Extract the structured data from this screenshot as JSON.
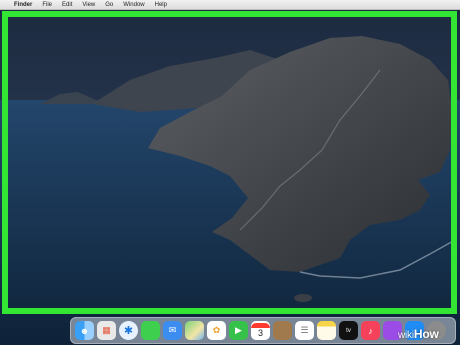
{
  "menubar": {
    "apple_glyph": "",
    "items": [
      "Finder",
      "File",
      "Edit",
      "View",
      "Go",
      "Window",
      "Help"
    ]
  },
  "dock": {
    "icons": [
      {
        "name": "finder-icon",
        "glyph": "☻"
      },
      {
        "name": "launchpad-icon",
        "glyph": "▦"
      },
      {
        "name": "safari-icon",
        "glyph": "✱"
      },
      {
        "name": "messages-icon",
        "glyph": "💬"
      },
      {
        "name": "mail-icon",
        "glyph": "✉"
      },
      {
        "name": "maps-icon",
        "glyph": ""
      },
      {
        "name": "photos-icon",
        "glyph": "✿"
      },
      {
        "name": "facetime-icon",
        "glyph": "▶"
      },
      {
        "name": "calendar-icon",
        "glyph": "3"
      },
      {
        "name": "contacts-icon",
        "glyph": ""
      },
      {
        "name": "reminders-icon",
        "glyph": "☰"
      },
      {
        "name": "notes-icon",
        "glyph": ""
      },
      {
        "name": "tv-icon",
        "glyph": "tv"
      },
      {
        "name": "music-icon",
        "glyph": "♪"
      },
      {
        "name": "podcasts-icon",
        "glyph": ""
      },
      {
        "name": "app-store-icon",
        "glyph": ""
      },
      {
        "name": "system-preferences-icon",
        "glyph": ""
      }
    ]
  },
  "watermark": {
    "prefix": "wiki",
    "suffix": "How"
  },
  "colors": {
    "highlight": "#33e633",
    "sky": "#1a2b44",
    "sea": "#14304f"
  }
}
